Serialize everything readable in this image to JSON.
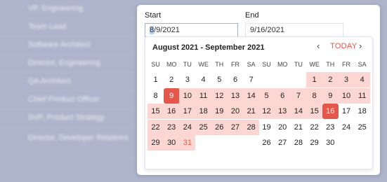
{
  "background_list": [
    "VP, Engineering",
    "Team Lead",
    "Software Architect",
    "Director, Engineering",
    "QA Architect",
    "Chief Product Officer",
    "SVP, Product Strategy",
    "Director, Developer Relations"
  ],
  "start": {
    "label": "Start",
    "value_highlight": "8",
    "value_rest": "/9/2021"
  },
  "end": {
    "label": "End",
    "value": "9/16/2021"
  },
  "calendar": {
    "title": "August 2021 - September 2021",
    "prev_label": "‹",
    "today_label": "TODAY",
    "next_label": "›",
    "weekdays": [
      "SU",
      "MO",
      "TU",
      "WE",
      "TH",
      "FR",
      "SA"
    ],
    "months": [
      {
        "name": "August 2021",
        "first_weekday": 0,
        "days": 31
      },
      {
        "name": "September 2021",
        "first_weekday": 3,
        "days": 30
      }
    ],
    "range_start": {
      "month": 0,
      "day": 9
    },
    "range_end": {
      "month": 1,
      "day": 16
    },
    "colors": {
      "accent": "#e4574a",
      "range": "#fbd6d2"
    }
  }
}
